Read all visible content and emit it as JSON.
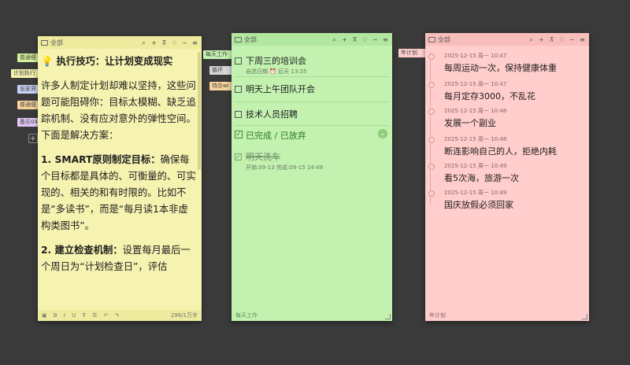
{
  "yellow_note": {
    "folder": "全部",
    "tabs": [
      "普通便",
      "计划执行",
      "张家界",
      "普通便",
      "备忘04"
    ],
    "tab_colors": [
      "#d6ef9a",
      "#f6f2b0",
      "#c6d2f6",
      "#f8d39c",
      "#e2c8f6"
    ],
    "heading": "执行技巧：让计划变成现实",
    "para1": "许多人制定计划却难以坚持，这些问题可能阻碍你：目标太模糊、缺乏追踪机制、没有应对意外的弹性空间。下面是解决方案：",
    "item1_title": "1. SMART原则制定目标：",
    "item1_text": "确保每个目标都是具体的、可衡量的、可实现的、相关的和有时限的。比如不是“多读书”，而是“每月读1本非虚构类图书”。",
    "item2_title": "2. 建立检查机制：",
    "item2_text": "设置每月最后一个周日为“计划检查日”，评估",
    "word_count": "296/1万字"
  },
  "green_note": {
    "folder": "全部",
    "tabs": [
      "每天工作",
      "循环",
      "待办wi"
    ],
    "tab_colors": [
      "#c2f1b0",
      "#d6d6d6",
      "#f8d39c"
    ],
    "todos": [
      {
        "text": "下周三的培训会",
        "meta": "自选日期   ⏰ 后天 13:35"
      },
      {
        "text": "明天上午团队开会",
        "meta": ""
      },
      {
        "text": "技术人员招聘",
        "meta": ""
      }
    ],
    "completed_label": "已完成 / 已放弃",
    "done_item": {
      "text": "明天洗车",
      "meta": "开始:09-13  完成:09-15 14:49"
    },
    "footer": "每天工作"
  },
  "pink_note": {
    "folder": "全部",
    "tabs": [
      "年计划"
    ],
    "tab_colors": [
      "#ffcdcb"
    ],
    "entries": [
      {
        "date": "2025-12-15 周一 10:47",
        "text": "每周运动一次，保持健康体重"
      },
      {
        "date": "2025-12-15 周一 10:47",
        "text": "每月定存3000，不乱花"
      },
      {
        "date": "2025-12-15 周一 10:48",
        "text": "发展一个副业"
      },
      {
        "date": "2025-12-15 周一 10:48",
        "text": "断连影响自己的人，拒绝内耗"
      },
      {
        "date": "2025-12-15 周一 10:49",
        "text": "看5次海，旅游一次"
      },
      {
        "date": "2025-12-15 周一 10:49",
        "text": "国庆放假必须回家"
      }
    ],
    "footer": "年计划"
  }
}
